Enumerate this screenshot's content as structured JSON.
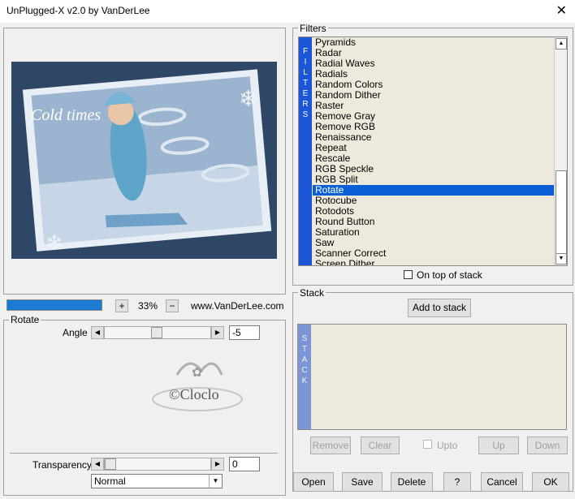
{
  "window": {
    "title": "UnPlugged-X v2.0 by VanDerLee",
    "close": "✕"
  },
  "preview": {
    "caption": "Cold times"
  },
  "zoom": {
    "plus": "+",
    "value": "33%",
    "minus": "−",
    "site": "www.VanDerLee.com",
    "progress": 1.0
  },
  "filters": {
    "group_label": "Filters",
    "strip": [
      "F",
      "I",
      "L",
      "T",
      "E",
      "R",
      "S"
    ],
    "items": [
      "Pyramids",
      "Radar",
      "Radial Waves",
      "Radials",
      "Random Colors",
      "Random Dither",
      "Raster",
      "Remove Gray",
      "Remove RGB",
      "Renaissance",
      "Repeat",
      "Rescale",
      "RGB Speckle",
      "RGB Split",
      "Rotate",
      "Rotocube",
      "Rotodots",
      "Round Button",
      "Saturation",
      "Saw",
      "Scanner Correct",
      "Screen Dither"
    ],
    "selected": "Rotate",
    "on_top_label": "On top of stack"
  },
  "rotate": {
    "group_label": "Rotate",
    "angle_label": "Angle",
    "angle_value": "-5",
    "angle_level": 0.49,
    "watermark": "©Cloclo",
    "transparency_label": "Transparency",
    "transparency_value": "0",
    "transparency_level": 0.0,
    "blend_mode": "Normal"
  },
  "stack": {
    "group_label": "Stack",
    "add_label": "Add to stack",
    "strip": [
      "S",
      "T",
      "A",
      "C",
      "K"
    ],
    "remove": "Remove",
    "clear": "Clear",
    "upto": "Upto",
    "up": "Up",
    "down": "Down"
  },
  "buttons": {
    "open": "Open",
    "save": "Save",
    "delete": "Delete",
    "help": "?",
    "cancel": "Cancel",
    "ok": "OK"
  },
  "arrows": {
    "left": "◀",
    "right": "▶",
    "up": "▲",
    "down": "▼"
  }
}
